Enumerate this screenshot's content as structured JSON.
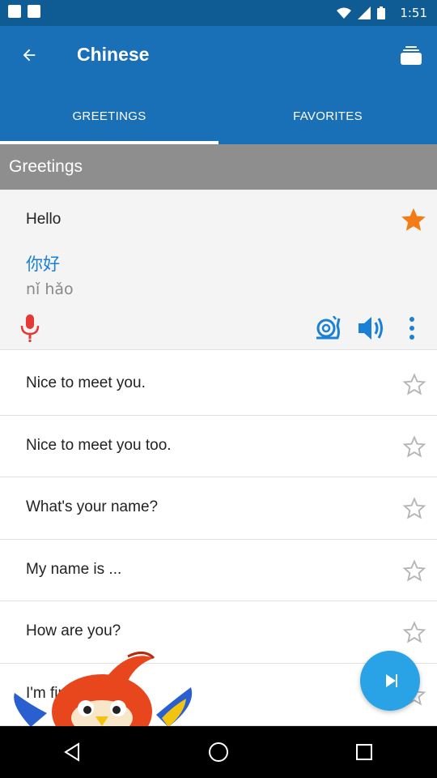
{
  "status_bar": {
    "time": "1:51",
    "icons": [
      "notification-square-icon",
      "notification-square-icon",
      "wifi-icon",
      "signal-icon",
      "battery-icon"
    ]
  },
  "app_bar": {
    "title": "Chinese",
    "back_icon": "arrow-left-icon",
    "right_icon": "stack-icon",
    "color": "#1a70b6"
  },
  "tabs": [
    {
      "label": "GREETINGS",
      "active": true
    },
    {
      "label": "FAVORITES",
      "active": false
    }
  ],
  "section": {
    "title": "Greetings"
  },
  "expanded_phrase": {
    "english": "Hello",
    "chinese": "你好",
    "pinyin": "nǐ hǎo",
    "favorited": true,
    "star_color": "#f47c16",
    "actions": [
      "microphone-icon",
      "snail-icon",
      "speaker-icon",
      "more-vert-icon"
    ]
  },
  "phrases": [
    {
      "english": "Nice to meet you.",
      "favorited": false
    },
    {
      "english": "Nice to meet you too.",
      "favorited": false
    },
    {
      "english": "What's your name?",
      "favorited": false
    },
    {
      "english": "My name is ...",
      "favorited": false
    },
    {
      "english": "How are you?",
      "favorited": false
    },
    {
      "english": "I'm fine",
      "favorited": false
    }
  ],
  "fab": {
    "icon": "play-icon",
    "color": "#2aa3e6"
  },
  "nav_bar": {
    "buttons": [
      "back-triangle-icon",
      "home-circle-icon",
      "recents-square-icon"
    ]
  }
}
